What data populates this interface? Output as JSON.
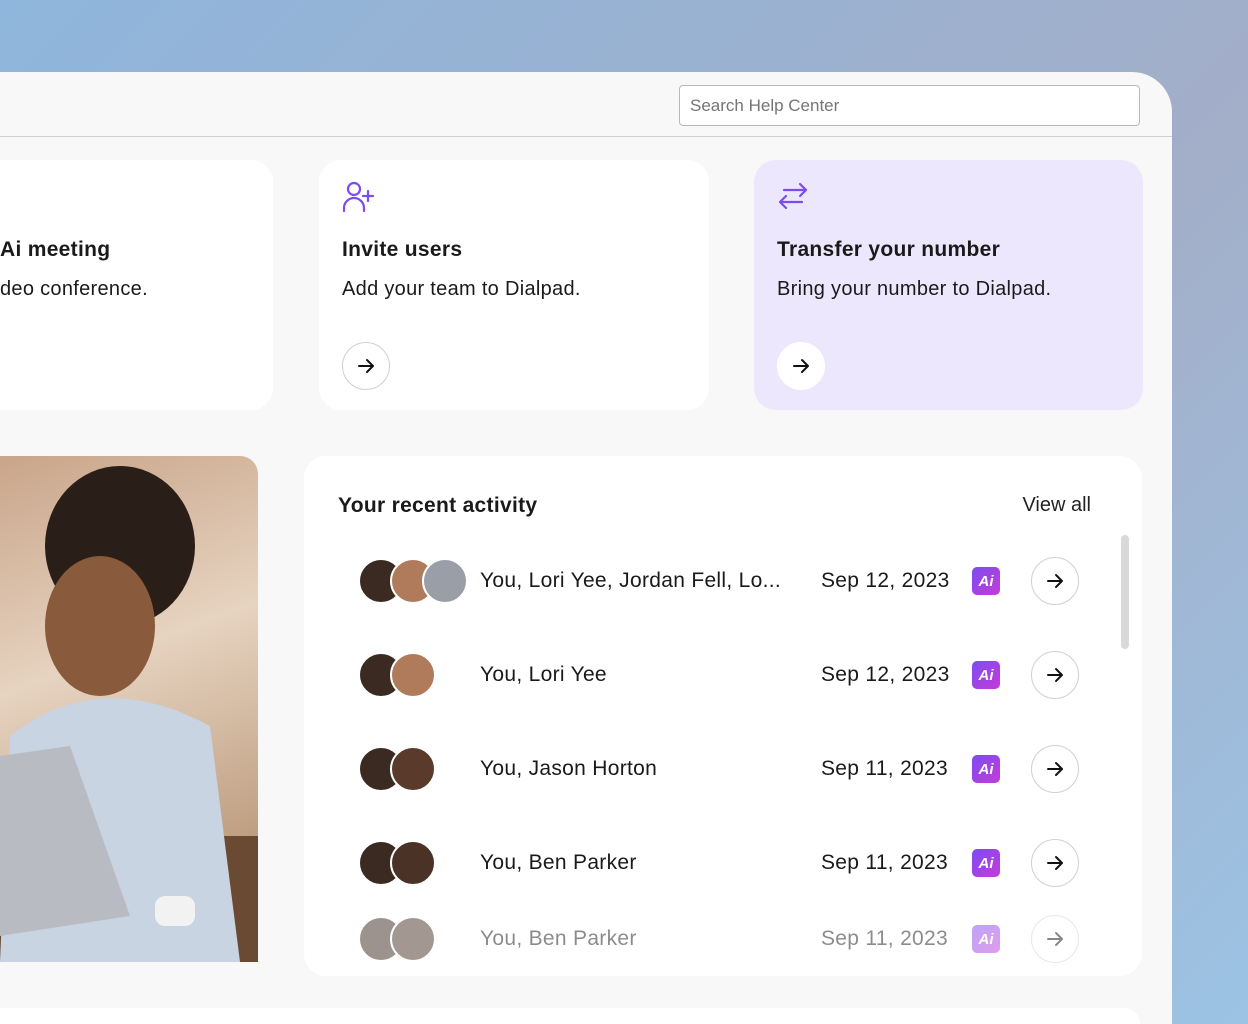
{
  "header": {
    "search_placeholder": "Search Help Center"
  },
  "cards": [
    {
      "title": "Ai meeting",
      "desc": "deo conference.",
      "icon": "video-icon"
    },
    {
      "title": "Invite users",
      "desc": "Add your team to Dialpad.",
      "icon": "user-plus-icon"
    },
    {
      "title": "Transfer your number",
      "desc": "Bring your number to Dialpad.",
      "icon": "transfer-arrows-icon"
    }
  ],
  "activity": {
    "title": "Your recent activity",
    "view_all": "View all",
    "rows": [
      {
        "name": "You, Lori Yee, Jordan Fell, Lo...",
        "date": "Sep 12, 2023",
        "badge": "Ai"
      },
      {
        "name": "You, Lori Yee",
        "date": "Sep 12, 2023",
        "badge": "Ai"
      },
      {
        "name": "You, Jason Horton",
        "date": "Sep 11, 2023",
        "badge": "Ai"
      },
      {
        "name": "You, Ben Parker",
        "date": "Sep 11, 2023",
        "badge": "Ai"
      },
      {
        "name": "You, Ben Parker",
        "date": "Sep 11, 2023",
        "badge": "Ai"
      }
    ]
  },
  "colors": {
    "accent": "#7c4dee",
    "highlight_card": "#ede7fd"
  }
}
